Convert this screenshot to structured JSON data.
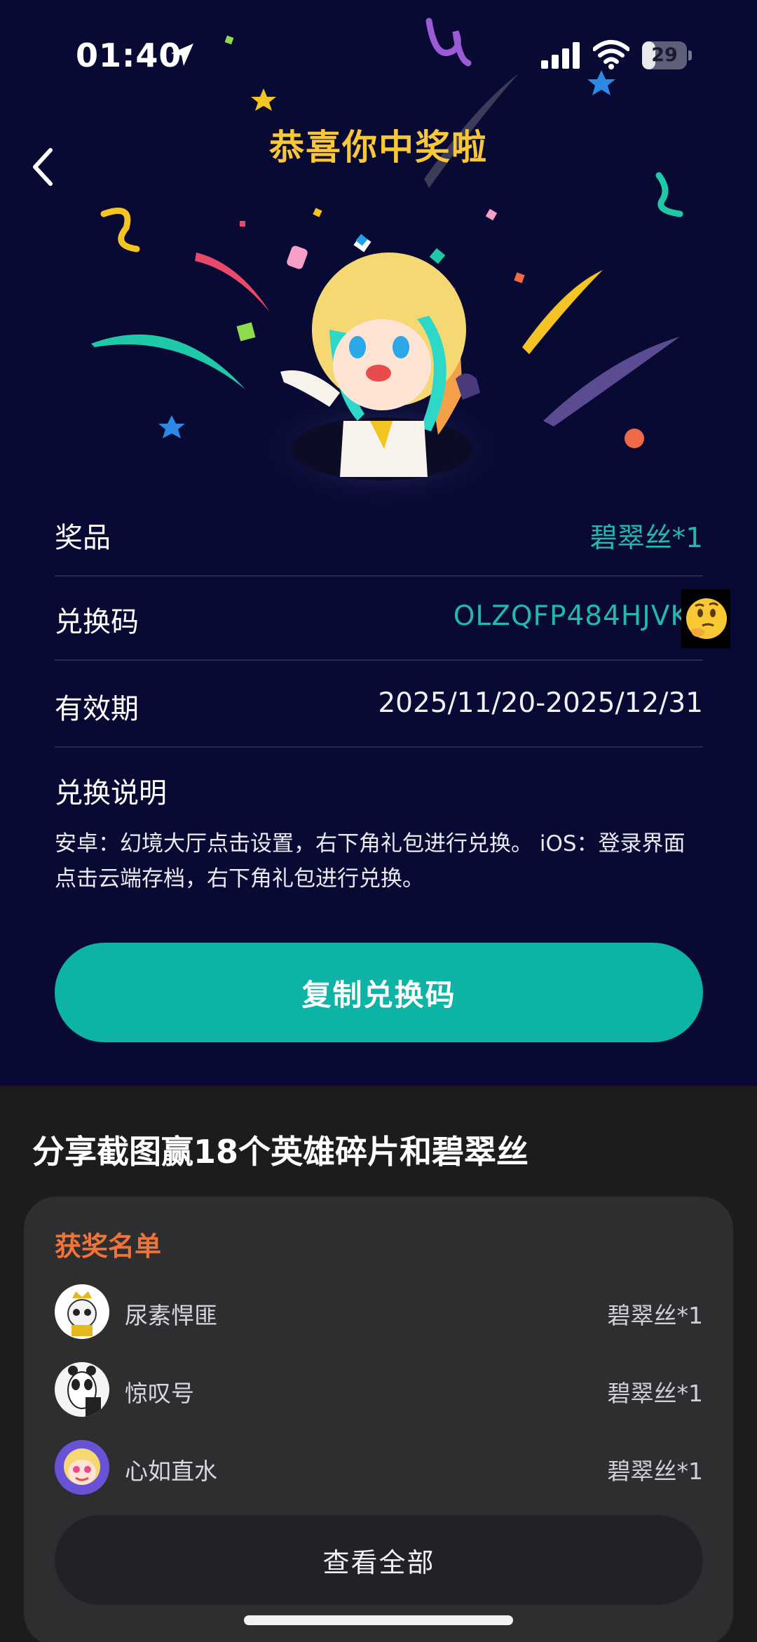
{
  "status_bar": {
    "time": "01:40",
    "battery": "29",
    "battery_level": 0.29
  },
  "header": {
    "title": "恭喜你中奖啦"
  },
  "prize": {
    "prize_label": "奖品",
    "prize_value": "碧翠丝*1",
    "code_label": "兑换码",
    "code_value": "OLZQFP484HJVK",
    "validity_label": "有效期",
    "validity_value": "2025/11/20-2025/12/31",
    "instructions_title": "兑换说明",
    "instructions_text": "安卓：幻境大厅点击设置，右下角礼包进行兑换。 iOS：登录界面点击云端存档，右下角礼包进行兑换。",
    "copy_button": "复制兑换码"
  },
  "share": {
    "title": "分享截图赢18个英雄碎片和碧翠丝",
    "winners_title": "获奖名单",
    "winners": [
      {
        "name": "尿素悍匪",
        "prize": "碧翠丝*1"
      },
      {
        "name": "惊叹号",
        "prize": "碧翠丝*1"
      },
      {
        "name": "心如直水",
        "prize": "碧翠丝*1"
      }
    ],
    "view_all": "查看全部"
  },
  "colors": {
    "accent_teal": "#0db3a4",
    "title_gold": "#f9c83a",
    "winners_orange": "#f0733a",
    "background_navy": "#080a33"
  },
  "icons": [
    "location-arrow-icon",
    "signal-icon",
    "wifi-icon",
    "battery-icon",
    "back-chevron-icon",
    "thinking-emoji-icon"
  ]
}
